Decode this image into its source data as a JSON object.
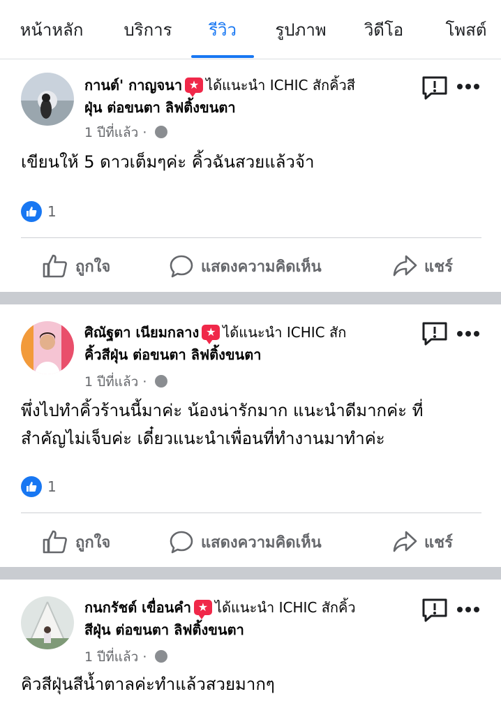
{
  "tabs": [
    {
      "label": "หน้าหลัก",
      "active": false
    },
    {
      "label": "บริการ",
      "active": false
    },
    {
      "label": "รีวิว",
      "active": true
    },
    {
      "label": "รูปภาพ",
      "active": false
    },
    {
      "label": "วิดีโอ",
      "active": false
    },
    {
      "label": "โพสต์",
      "active": false
    }
  ],
  "colors": {
    "accent": "#1877f2",
    "recommend_badge": "#f02849",
    "secondary_text": "#65676b",
    "separator": "#c9ccd1"
  },
  "icons": {
    "recommend": "recommend-star-icon",
    "report": "report-icon",
    "more": "more-dots-icon",
    "privacy": "globe-icon",
    "like": "like-thumb-icon",
    "comment": "comment-bubble-icon",
    "share": "share-arrow-icon"
  },
  "reviews": [
    {
      "author_line1": "กานต์' กาญจนา",
      "recommends": "ได้แนะนำ ICHIC สักคิ้วสี",
      "author_line2": "ฝุ่น ต่อขนตา ลิฟติ้งขนตา",
      "time": "1 ปีที่แล้ว",
      "dot": "·",
      "text": "เขียนให้ 5 ดาวเต็มๆค่ะ คิ้วฉันสวยแล้วจ้า",
      "likes": "1"
    },
    {
      "author_line1": "ศิณัฐตา เนียมกลาง",
      "recommends": "ได้แนะนำ ICHIC สัก",
      "author_line2": "คิ้วสีฝุ่น ต่อขนตา ลิฟติ้งขนตา",
      "time": "1 ปีที่แล้ว",
      "dot": "·",
      "text": "พึ่งไปทำคิ้วร้านนี้มาค่ะ น้องน่ารักมาก แนะนำดีมากค่ะ ที่สำคัญไม่เจ็บค่ะ เดี๋ยวแนะนำเพื่อนที่ทำงานมาทำค่ะ",
      "likes": "1"
    },
    {
      "author_line1": "กนกรัชต์ เขื่อนคำ",
      "recommends": "ได้แนะนำ ICHIC สักคิ้ว",
      "author_line2": "สีฝุ่น ต่อขนตา ลิฟติ้งขนตา",
      "time": "1 ปีที่แล้ว",
      "dot": "·",
      "text": "คิวสีฝุ่นสีน้ำตาลค่ะทำแล้วสวยมากๆ"
    }
  ],
  "actions": {
    "like": "ถูกใจ",
    "comment": "แสดงความคิดเห็น",
    "share": "แชร์"
  }
}
